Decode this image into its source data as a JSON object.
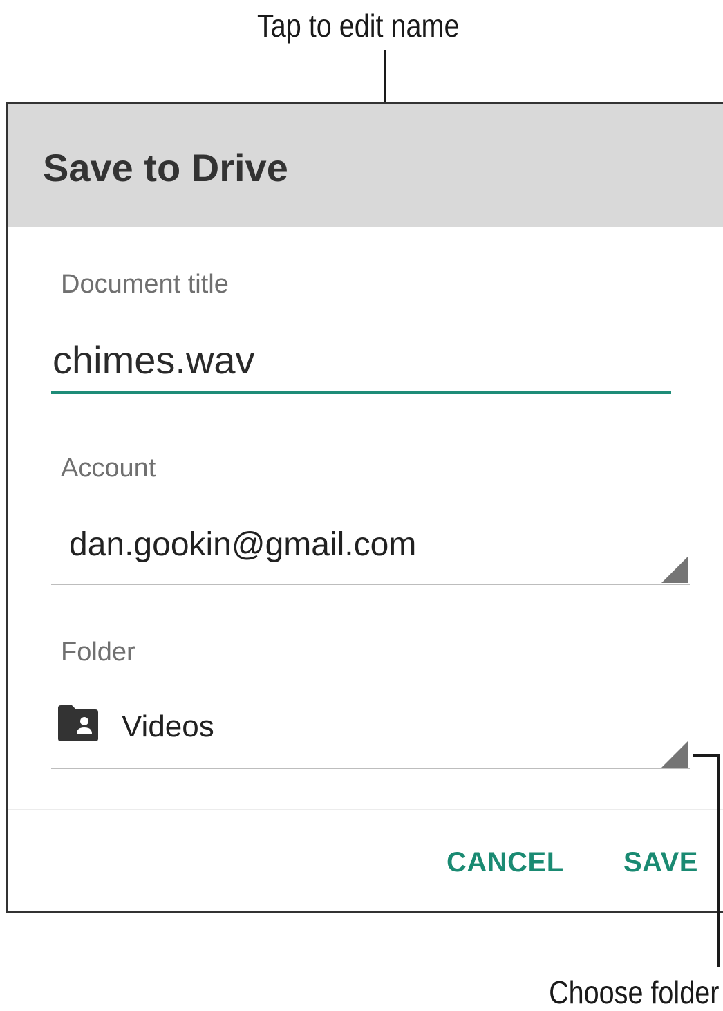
{
  "callouts": {
    "top": "Tap to edit name",
    "bottom": "Choose folder"
  },
  "dialog": {
    "title": "Save to Drive",
    "document_title": {
      "label": "Document title",
      "value": "chimes.wav"
    },
    "account": {
      "label": "Account",
      "value": "dan.gookin@gmail.com"
    },
    "folder": {
      "label": "Folder",
      "value": "Videos",
      "icon": "shared-folder-icon"
    },
    "buttons": {
      "cancel": "CANCEL",
      "save": "SAVE"
    }
  },
  "colors": {
    "header_bg": "#d9d9d9",
    "accent": "#1a8a72",
    "focused_underline": "#1e8c78"
  }
}
